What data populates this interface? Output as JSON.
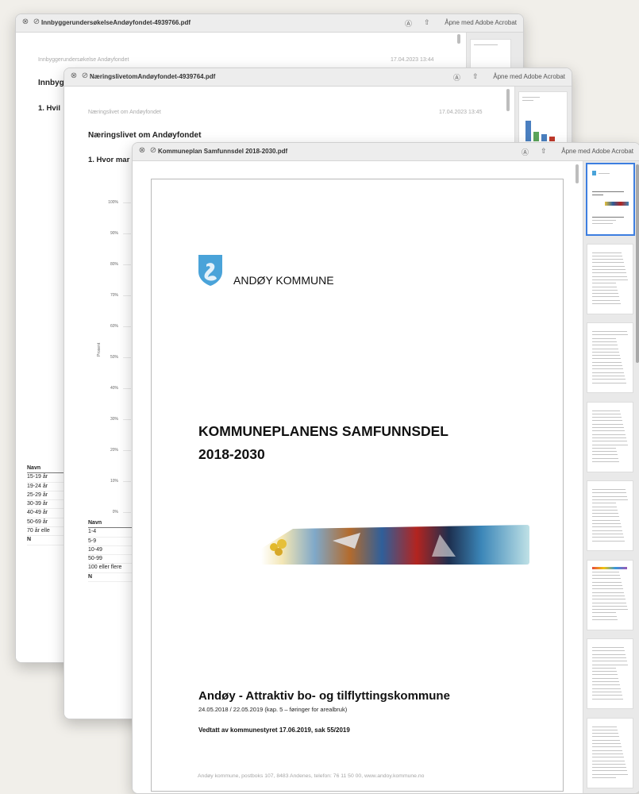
{
  "windows": [
    {
      "title": "InnbyggerundersøkelseAndøyfondet-4939766.pdf",
      "open_with": "Åpne med Adobe Acrobat",
      "page_header_left": "Innbyggerundersøkelse Andøyfondet",
      "page_header_right": "17.04.2023 13:44",
      "heading": "Innbyg",
      "question": "1. Hvil",
      "table_header": "Navn",
      "table_rows": [
        "15-19 år",
        "19-24 år",
        "25-29 år",
        "30-39 år",
        "40-49 år",
        "50-69 år",
        "70 år elle"
      ],
      "table_total": "N"
    },
    {
      "title": "NæringslivetomAndøyfondet-4939764.pdf",
      "open_with": "Åpne med Adobe Acrobat",
      "page_header_left": "Næringslivet om Andøyfondet",
      "page_header_right": "17.04.2023 13:45",
      "heading": "Næringslivet om Andøyfondet",
      "question": "1. Hvor mar",
      "y_axis_label": "Prosent",
      "y_ticks": [
        "100%",
        "90%",
        "80%",
        "70%",
        "60%",
        "50%",
        "40%",
        "30%",
        "20%",
        "10%",
        "0%"
      ],
      "table_header": "Navn",
      "table_rows": [
        "1-4",
        "5-9",
        "10-49",
        "50-99",
        "100 eller flere"
      ],
      "table_total": "N"
    },
    {
      "title": "Kommuneplan Samfunnsdel 2018-2030.pdf",
      "open_with": "Åpne med Adobe Acrobat",
      "municipality": "ANDØY KOMMUNE",
      "doc_title_line1": "KOMMUNEPLANENS SAMFUNNSDEL",
      "doc_title_line2": "2018-2030",
      "subtitle": "Andøy - Attraktiv bo- og tilflyttingskommune",
      "dates": "24.05.2018 / 22.05.2019 (kap. 5 – føringer for arealbruk)",
      "adopted": "Vedtatt av kommunestyret 17.06.2019, sak 55/2019",
      "footer": "Andøy kommune, postboks 107, 8483 Andenes, telefon: 76 11 50 00, www.andoy.kommune.no"
    }
  ],
  "icons": {
    "close": "close-icon",
    "info": "info-icon",
    "share": "share-icon",
    "coat_of_arms": "coat-of-arms-icon"
  },
  "colors": {
    "selection": "#3d7ee0",
    "crest_blue": "#4aa3d9",
    "bar_blue": "#4a7fc0",
    "bar_green": "#5ba55a",
    "bar_red": "#c0392b"
  }
}
